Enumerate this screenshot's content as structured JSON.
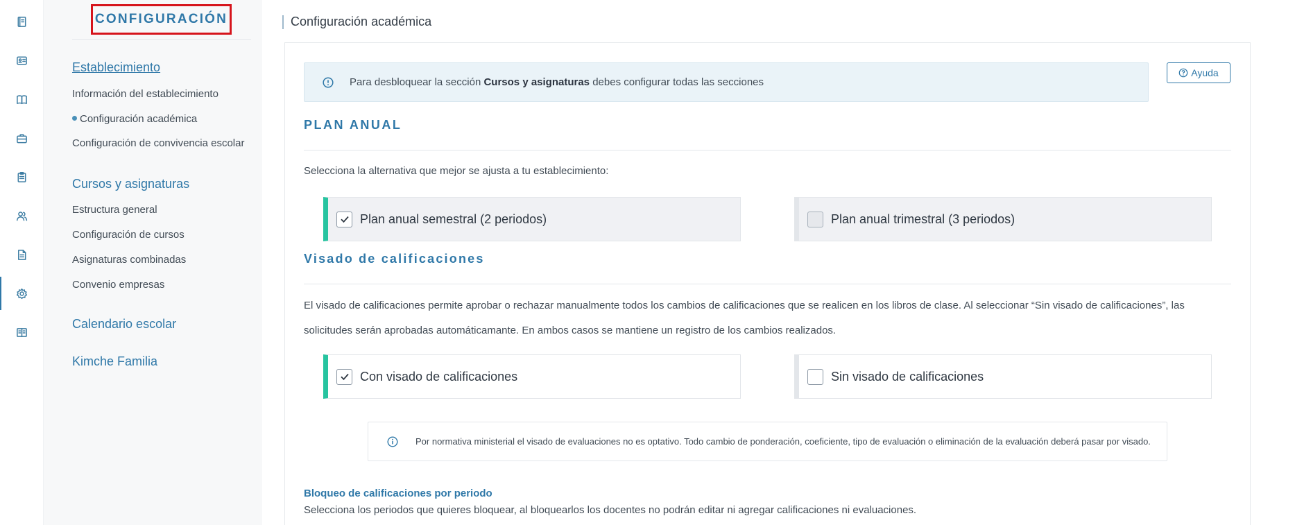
{
  "rail": {
    "icons": [
      "notebook-icon",
      "id-card-icon",
      "book-icon",
      "briefcase-icon",
      "clipboard-icon",
      "users-icon",
      "document-icon",
      "gear-icon",
      "open-book-icon"
    ],
    "active": "gear-icon"
  },
  "sidebar": {
    "title": "CONFIGURACIÓN",
    "sections": [
      {
        "label": "Establecimiento",
        "items": [
          "Información del establecimiento",
          "Configuración académica",
          "Configuración de convivencia escolar"
        ]
      },
      {
        "label": "Cursos y asignaturas",
        "items": [
          "Estructura general",
          "Configuración de cursos",
          "Asignaturas combinadas",
          "Convenio empresas"
        ]
      },
      {
        "label": "Calendario escolar",
        "items": []
      },
      {
        "label": "Kimche Familia",
        "items": []
      }
    ],
    "active_item": "Configuración académica"
  },
  "main": {
    "breadcrumb": "Configuración académica",
    "alert": {
      "before": "Para desbloquear la sección ",
      "bold": "Cursos y asignaturas",
      "after": " debes configurar todas las secciones"
    },
    "help_label": "Ayuda",
    "plan": {
      "heading": "PLAN ANUAL",
      "prompt": "Selecciona la alternativa que mejor se ajusta a tu establecimiento:",
      "options": [
        {
          "label": "Plan anual semestral (2 periodos)",
          "checked": true
        },
        {
          "label": "Plan anual trimestral (3 periodos)",
          "checked": false
        }
      ]
    },
    "visado": {
      "heading": "Visado de calificaciones",
      "description": "El visado de calificaciones permite aprobar o rechazar manualmente todos los cambios de calificaciones que se realicen en los libros de clase. Al seleccionar “Sin visado de calificaciones”, las solicitudes serán aprobadas automáticamante. En ambos casos se mantiene un registro de los cambios realizados.",
      "options": [
        {
          "label": "Con visado de calificaciones",
          "checked": true
        },
        {
          "label": "Sin visado de calificaciones",
          "checked": false
        }
      ],
      "note": "Por normativa ministerial el visado de evaluaciones no es optativo. Todo cambio de ponderación, coeficiente, tipo de evaluación o eliminación de la evaluación deberá pasar por visado."
    },
    "bloqueo": {
      "heading": "Bloqueo de calificaciones por periodo",
      "description": "Selecciona los periodos que quieres bloquear, al bloquearlos los docentes no podrán editar ni agregar calificaciones ni evaluaciones."
    }
  },
  "colors": {
    "accent": "#2f78a8",
    "selected_bar": "#27c4a0",
    "highlight_box": "#d6141c",
    "alert_bg": "#eaf3f8"
  }
}
